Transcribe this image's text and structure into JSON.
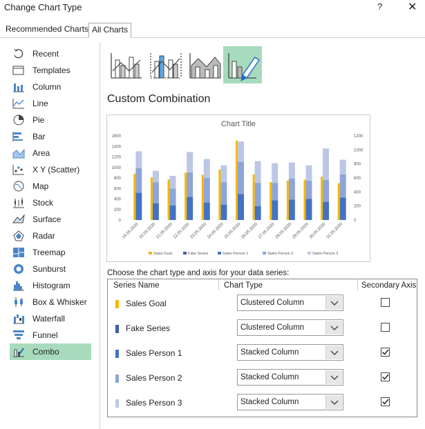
{
  "window": {
    "title": "Change Chart Type",
    "help": "?",
    "close": "✕"
  },
  "tabs": [
    {
      "label": "Recommended Charts"
    },
    {
      "label": "All Charts"
    }
  ],
  "sidebar": {
    "items": [
      {
        "label": "Recent",
        "icon": "recent-icon"
      },
      {
        "label": "Templates",
        "icon": "templates-icon"
      },
      {
        "label": "Column",
        "icon": "column-chart-icon"
      },
      {
        "label": "Line",
        "icon": "line-chart-icon"
      },
      {
        "label": "Pie",
        "icon": "pie-chart-icon"
      },
      {
        "label": "Bar",
        "icon": "bar-chart-icon"
      },
      {
        "label": "Area",
        "icon": "area-chart-icon"
      },
      {
        "label": "X Y (Scatter)",
        "icon": "scatter-chart-icon"
      },
      {
        "label": "Map",
        "icon": "map-chart-icon"
      },
      {
        "label": "Stock",
        "icon": "stock-chart-icon"
      },
      {
        "label": "Surface",
        "icon": "surface-chart-icon"
      },
      {
        "label": "Radar",
        "icon": "radar-chart-icon"
      },
      {
        "label": "Treemap",
        "icon": "treemap-chart-icon"
      },
      {
        "label": "Sunburst",
        "icon": "sunburst-chart-icon"
      },
      {
        "label": "Histogram",
        "icon": "histogram-chart-icon"
      },
      {
        "label": "Box & Whisker",
        "icon": "box-whisker-chart-icon"
      },
      {
        "label": "Waterfall",
        "icon": "waterfall-chart-icon"
      },
      {
        "label": "Funnel",
        "icon": "funnel-chart-icon"
      },
      {
        "label": "Combo",
        "icon": "combo-chart-icon",
        "selected": true
      }
    ]
  },
  "subtypes": {
    "selected_index": 3
  },
  "section_title": "Custom Combination",
  "choose_label": "Choose the chart type and axis for your data series:",
  "table": {
    "headers": {
      "name": "Series Name",
      "type": "Chart Type",
      "axis": "Secondary Axis"
    },
    "rows": [
      {
        "name": "Sales Goal",
        "color": "#f5b800",
        "type": "Clustered Column",
        "secondary": false
      },
      {
        "name": "Fake Series",
        "color": "#3f5ea8",
        "type": "Clustered Column",
        "secondary": false
      },
      {
        "name": "Sales Person 1",
        "color": "#4472c4",
        "type": "Stacked Column",
        "secondary": true
      },
      {
        "name": "Sales Person 2",
        "color": "#8ea5d8",
        "type": "Stacked Column",
        "secondary": true
      },
      {
        "name": "Sales Person 3",
        "color": "#bcc7e6",
        "type": "Stacked Column",
        "secondary": true
      }
    ]
  },
  "chart_data": {
    "type": "bar",
    "title": "Chart Title",
    "categories": [
      "19.05.2020",
      "20.05.2020",
      "21.05.2020",
      "22.05.2020",
      "23.05.2020",
      "24.05.2020",
      "25.05.2020",
      "26.05.2020",
      "27.05.2020",
      "28.05.2020",
      "29.05.2020",
      "30.05.2020",
      "31.05.2020"
    ],
    "y_left": {
      "range": [
        0,
        1600
      ],
      "ticks": [
        0,
        200,
        400,
        600,
        800,
        1000,
        1200,
        1400,
        1600
      ]
    },
    "y_right": {
      "range": [
        0,
        1200
      ],
      "ticks": [
        0,
        200,
        400,
        600,
        800,
        1000,
        1200
      ]
    },
    "grid": false,
    "legend_position": "bottom",
    "legend": [
      "Sales Goal",
      "Fake Series",
      "Sales Person 1",
      "Sales Person 2",
      "Sales Person 3"
    ],
    "series": [
      {
        "name": "Sales Goal",
        "axis": "left",
        "color": "#f5b800",
        "values": [
          880,
          810,
          770,
          900,
          860,
          960,
          1510,
          870,
          720,
          750,
          770,
          820,
          700
        ]
      },
      {
        "name": "Fake Series",
        "axis": "left",
        "color": "#3f5ea8",
        "values": [
          0,
          0,
          0,
          0,
          0,
          0,
          0,
          0,
          0,
          0,
          0,
          0,
          0
        ]
      },
      {
        "name": "Sales Person 1",
        "axis": "right",
        "color": "#4472c4",
        "values": [
          390,
          240,
          210,
          330,
          250,
          220,
          370,
          200,
          280,
          290,
          300,
          260,
          320
        ]
      },
      {
        "name": "Sales Person 2",
        "axis": "right",
        "color": "#8ea5d8",
        "values": [
          350,
          300,
          240,
          350,
          350,
          320,
          460,
          330,
          250,
          300,
          260,
          310,
          330
        ]
      },
      {
        "name": "Sales Person 3",
        "axis": "right",
        "color": "#bcc7e6",
        "values": [
          240,
          160,
          180,
          290,
          270,
          240,
          290,
          310,
          280,
          230,
          220,
          450,
          210
        ]
      }
    ]
  }
}
